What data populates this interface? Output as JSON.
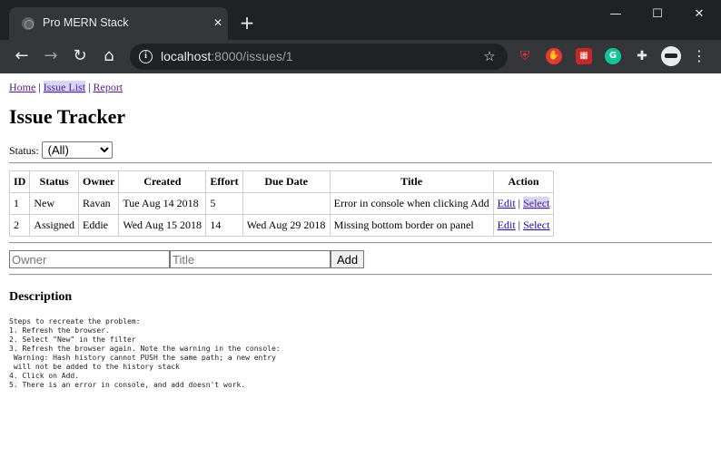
{
  "browser": {
    "tab_title": "Pro MERN Stack",
    "url_host": "localhost",
    "url_path": ":8000/issues/1"
  },
  "nav": {
    "home": "Home",
    "issue_list": "Issue List",
    "report": "Report",
    "separator": "|"
  },
  "page_title": "Issue Tracker",
  "filter": {
    "label": "Status:",
    "selected": "(All)"
  },
  "table": {
    "headers": [
      "ID",
      "Status",
      "Owner",
      "Created",
      "Effort",
      "Due Date",
      "Title",
      "Action"
    ],
    "rows": [
      {
        "id": "1",
        "status": "New",
        "owner": "Ravan",
        "created": "Tue Aug 14 2018",
        "effort": "5",
        "due": "",
        "title": "Error in console when clicking Add",
        "edit": "Edit",
        "select": "Select"
      },
      {
        "id": "2",
        "status": "Assigned",
        "owner": "Eddie",
        "created": "Wed Aug 15 2018",
        "effort": "14",
        "due": "Wed Aug 29 2018",
        "title": "Missing bottom border on panel",
        "edit": "Edit",
        "select": "Select"
      }
    ]
  },
  "add_form": {
    "owner_placeholder": "Owner",
    "title_placeholder": "Title",
    "add_label": "Add"
  },
  "description": {
    "heading": "Description",
    "text": "Steps to recreate the problem:\n1. Refresh the browser.\n2. Select \"New\" in the filter\n3. Refresh the browser again. Note the warning in the console:\n Warning: Hash history cannot PUSH the same path; a new entry\n will not be added to the history stack\n4. Click on Add.\n5. There is an error in console, and add doesn't work."
  },
  "colors": {
    "chrome_dark": "#202124",
    "chrome_toolbar": "#35363a",
    "link": "#1a0dab",
    "visited_link": "#551a8b"
  }
}
